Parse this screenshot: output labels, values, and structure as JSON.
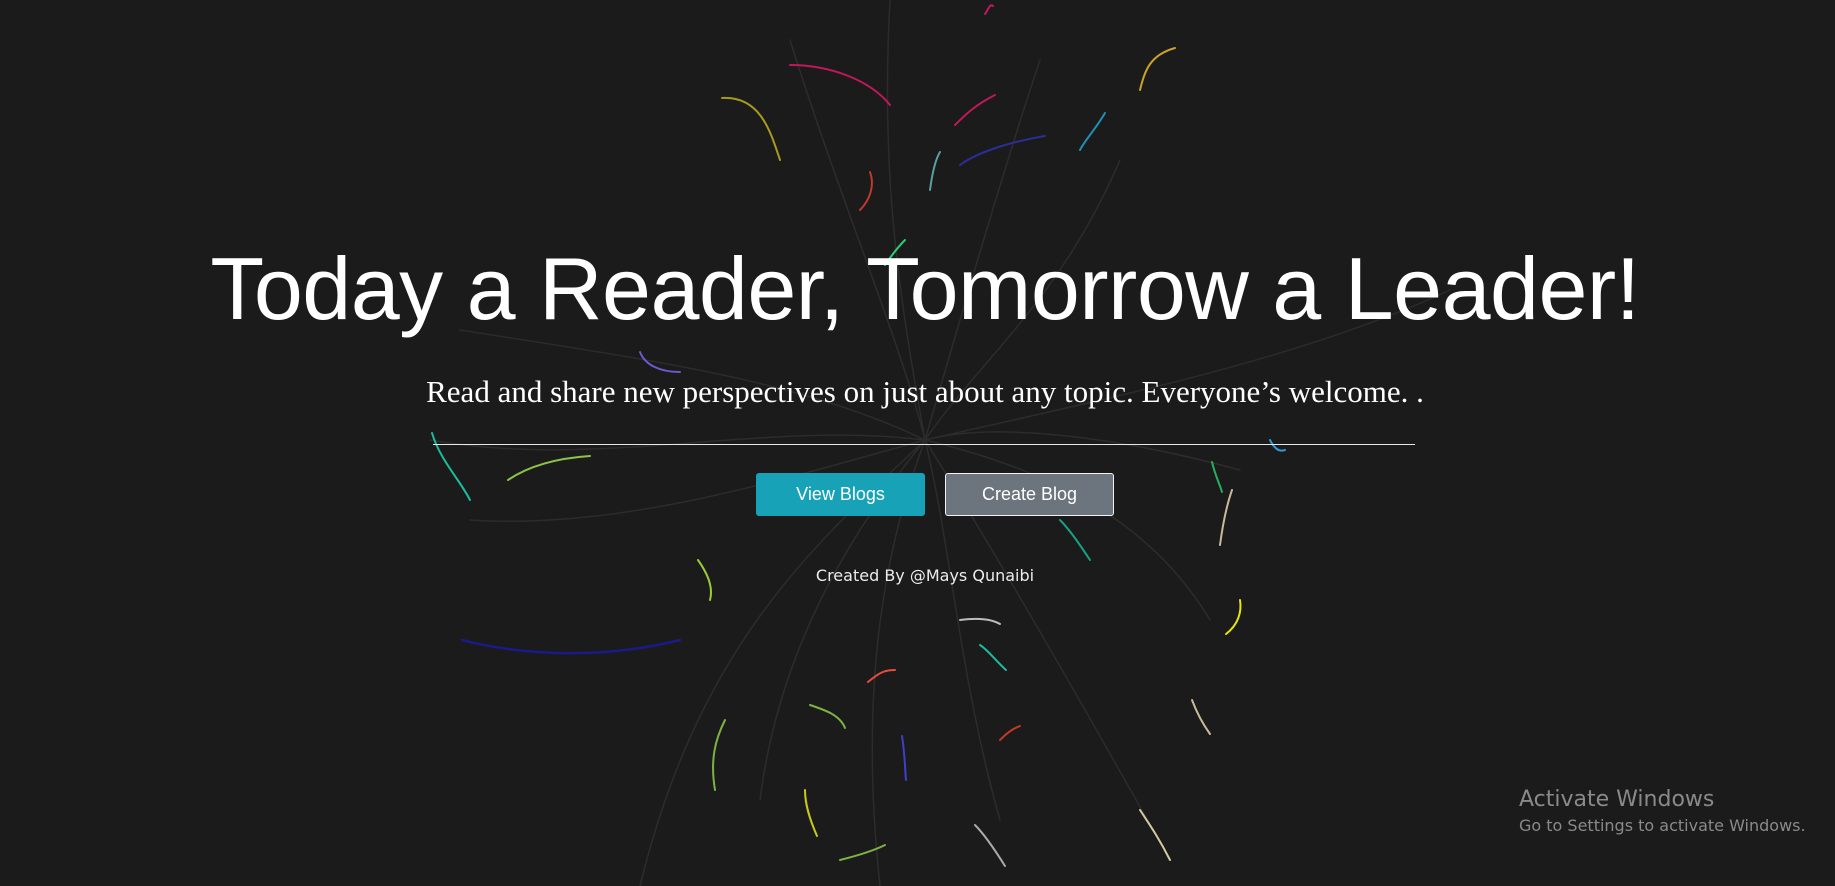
{
  "hero": {
    "title": "Today a Reader, Tomorrow a Leader!",
    "subtitle": "Read and share new perspectives on just about any topic. Everyone’s welcome. .",
    "buttons": {
      "view_blogs": "View Blogs",
      "create_blog": "Create Blog"
    },
    "credit": "Created By @Mays Qunaibi"
  },
  "watermark": {
    "title": "Activate Windows",
    "subtitle": "Go to Settings to activate Windows."
  },
  "colors": {
    "background": "#1b1b1b",
    "primary_button": "#17a2b8",
    "secondary_button": "#6c757d",
    "text": "#ffffff",
    "watermark_text": "#8a8a8a"
  }
}
